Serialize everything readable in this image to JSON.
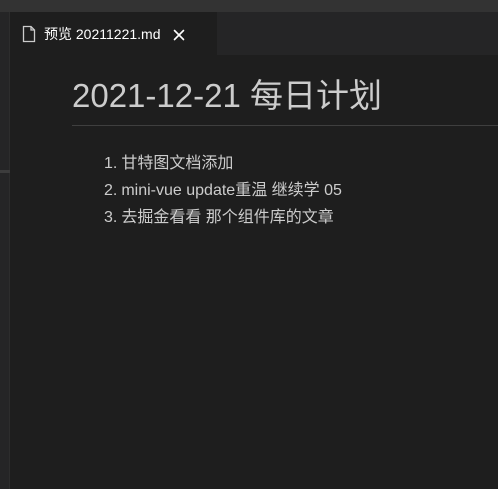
{
  "tab": {
    "label": "预览 20211221.md",
    "icon": "file-icon",
    "close_icon": "close-icon"
  },
  "document": {
    "heading": "2021-12-21 每日计划",
    "items": [
      {
        "number": "1.",
        "text": "甘特图文档添加"
      },
      {
        "number": "2.",
        "text": "mini-vue update重温 继续学 05"
      },
      {
        "number": "3.",
        "text": "去掘金看看 那个组件库的文章"
      }
    ]
  },
  "colors": {
    "background": "#1e1e1e",
    "tabbar": "#252526",
    "text": "#cccccc",
    "tab_text": "#ffffff"
  }
}
